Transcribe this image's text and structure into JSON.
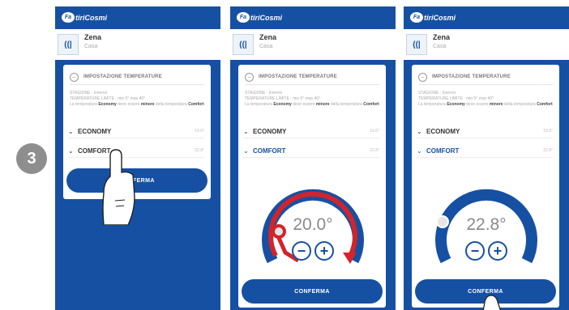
{
  "step": "3",
  "brand": {
    "mark": "Fa",
    "name": "tiriCosmi",
    "accent": "#1650a3"
  },
  "zone": {
    "name": "Zena",
    "sub": "Casa",
    "icon": "thermostat-icon"
  },
  "card": {
    "title": "IMPOSTAZIONE TEMPERATURE",
    "desc_lines": [
      "STAGIONE : Inverno",
      "TEMPERATURE LIMITE : min 5°  max 40°"
    ],
    "desc_a": "La temperatura ",
    "desc_b": "Economy",
    "desc_c": " deve essere ",
    "desc_d": "minore",
    "desc_e": " della temperatura ",
    "desc_f": "Comfort",
    "desc_g": "."
  },
  "modes": {
    "economy": {
      "label": "ECONOMY",
      "value": "19.0°"
    },
    "comfort": {
      "label": "COMFORT",
      "value": "22.8°"
    }
  },
  "confirm_label": "CONFERMA",
  "screens": [
    {
      "dial": null
    },
    {
      "dial": {
        "value_text": "20.0°",
        "minus": "−",
        "plus": "+"
      }
    },
    {
      "dial": {
        "value_text": "22.8°",
        "minus": "−",
        "plus": "+"
      }
    }
  ]
}
